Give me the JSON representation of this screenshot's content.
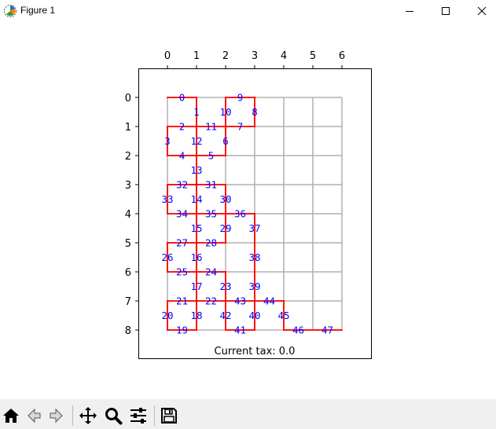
{
  "window": {
    "title": "Figure 1",
    "icon": "matplotlib-icon",
    "controls": [
      "minimize-icon",
      "maximize-icon",
      "close-icon"
    ]
  },
  "toolbar": {
    "buttons": [
      "home-icon",
      "back-icon",
      "forward-icon",
      "pan-icon",
      "zoom-icon",
      "configure-subplots-icon",
      "save-icon"
    ]
  },
  "colors": {
    "frame": "#ff0000",
    "labels": "#0000ff",
    "grid": "#b0b0b0"
  },
  "chart_data": {
    "type": "grid-graph",
    "x_ticks": [
      "0",
      "1",
      "2",
      "3",
      "4",
      "5",
      "6"
    ],
    "y_ticks": [
      "0",
      "1",
      "2",
      "3",
      "4",
      "5",
      "6",
      "7",
      "8"
    ],
    "xlim": [
      -1,
      7
    ],
    "ylim": [
      9,
      -1
    ],
    "x_axis_position": "top",
    "grid": true,
    "status_text": "Current tax: 0.0",
    "nodes": [
      {
        "id": "0",
        "x": 0.5,
        "y": 0
      },
      {
        "id": "1",
        "x": 1,
        "y": 0.5
      },
      {
        "id": "2",
        "x": 0.5,
        "y": 1
      },
      {
        "id": "3",
        "x": 0,
        "y": 1.5
      },
      {
        "id": "4",
        "x": 0.5,
        "y": 2
      },
      {
        "id": "5",
        "x": 1.5,
        "y": 2
      },
      {
        "id": "6",
        "x": 2,
        "y": 1.5
      },
      {
        "id": "7",
        "x": 2.5,
        "y": 1
      },
      {
        "id": "8",
        "x": 3,
        "y": 0.5
      },
      {
        "id": "9",
        "x": 2.5,
        "y": 0
      },
      {
        "id": "10",
        "x": 2,
        "y": 0.5
      },
      {
        "id": "11",
        "x": 1.5,
        "y": 1
      },
      {
        "id": "12",
        "x": 1,
        "y": 1.5
      },
      {
        "id": "13",
        "x": 1,
        "y": 2.5
      },
      {
        "id": "14",
        "x": 1,
        "y": 3.5
      },
      {
        "id": "15",
        "x": 1,
        "y": 4.5
      },
      {
        "id": "16",
        "x": 1,
        "y": 5.5
      },
      {
        "id": "17",
        "x": 1,
        "y": 6.5
      },
      {
        "id": "18",
        "x": 1,
        "y": 7.5
      },
      {
        "id": "19",
        "x": 0.5,
        "y": 8
      },
      {
        "id": "20",
        "x": 0,
        "y": 7.5
      },
      {
        "id": "21",
        "x": 0.5,
        "y": 7
      },
      {
        "id": "22",
        "x": 1.5,
        "y": 7
      },
      {
        "id": "23",
        "x": 2,
        "y": 6.5
      },
      {
        "id": "24",
        "x": 1.5,
        "y": 6
      },
      {
        "id": "25",
        "x": 0.5,
        "y": 6
      },
      {
        "id": "26",
        "x": 0,
        "y": 5.5
      },
      {
        "id": "27",
        "x": 0.5,
        "y": 5
      },
      {
        "id": "28",
        "x": 1.5,
        "y": 5
      },
      {
        "id": "29",
        "x": 2,
        "y": 4.5
      },
      {
        "id": "30",
        "x": 2,
        "y": 3.5
      },
      {
        "id": "31",
        "x": 1.5,
        "y": 3
      },
      {
        "id": "32",
        "x": 0.5,
        "y": 3
      },
      {
        "id": "33",
        "x": 0,
        "y": 3.5
      },
      {
        "id": "34",
        "x": 0.5,
        "y": 4
      },
      {
        "id": "35",
        "x": 1.5,
        "y": 4
      },
      {
        "id": "36",
        "x": 2.5,
        "y": 4
      },
      {
        "id": "37",
        "x": 3,
        "y": 4.5
      },
      {
        "id": "38",
        "x": 3,
        "y": 5.5
      },
      {
        "id": "39",
        "x": 3,
        "y": 6.5
      },
      {
        "id": "40",
        "x": 3,
        "y": 7.5
      },
      {
        "id": "41",
        "x": 2.5,
        "y": 8
      },
      {
        "id": "42",
        "x": 2,
        "y": 7.5
      },
      {
        "id": "43",
        "x": 2.5,
        "y": 7
      },
      {
        "id": "44",
        "x": 3.5,
        "y": 7
      },
      {
        "id": "45",
        "x": 4,
        "y": 7.5
      },
      {
        "id": "46",
        "x": 4.5,
        "y": 8
      },
      {
        "id": "47",
        "x": 5.5,
        "y": 8
      }
    ],
    "red_edges": [
      [
        [
          0,
          0
        ],
        [
          1,
          0
        ]
      ],
      [
        [
          1,
          0
        ],
        [
          1,
          1
        ]
      ],
      [
        [
          0,
          1
        ],
        [
          2,
          1
        ]
      ],
      [
        [
          0,
          1
        ],
        [
          0,
          2
        ]
      ],
      [
        [
          0,
          2
        ],
        [
          2,
          2
        ]
      ],
      [
        [
          2,
          1
        ],
        [
          2,
          2
        ]
      ],
      [
        [
          2,
          0
        ],
        [
          3,
          0
        ]
      ],
      [
        [
          2,
          0
        ],
        [
          2,
          1
        ]
      ],
      [
        [
          3,
          0
        ],
        [
          3,
          1
        ]
      ],
      [
        [
          2,
          1
        ],
        [
          3,
          1
        ]
      ],
      [
        [
          1,
          1
        ],
        [
          1,
          3
        ]
      ],
      [
        [
          0,
          3
        ],
        [
          2,
          3
        ]
      ],
      [
        [
          0,
          3
        ],
        [
          0,
          4
        ]
      ],
      [
        [
          0,
          4
        ],
        [
          3,
          4
        ]
      ],
      [
        [
          2,
          3
        ],
        [
          2,
          5
        ]
      ],
      [
        [
          1,
          3
        ],
        [
          1,
          8
        ]
      ],
      [
        [
          3,
          4
        ],
        [
          3,
          8
        ]
      ],
      [
        [
          0,
          5
        ],
        [
          2,
          5
        ]
      ],
      [
        [
          0,
          5
        ],
        [
          0,
          6
        ]
      ],
      [
        [
          0,
          6
        ],
        [
          2,
          6
        ]
      ],
      [
        [
          2,
          6
        ],
        [
          2,
          8
        ]
      ],
      [
        [
          0,
          7
        ],
        [
          4,
          7
        ]
      ],
      [
        [
          0,
          7
        ],
        [
          0,
          8
        ]
      ],
      [
        [
          0,
          8
        ],
        [
          1,
          8
        ]
      ],
      [
        [
          2,
          8
        ],
        [
          3,
          8
        ]
      ],
      [
        [
          4,
          7
        ],
        [
          4,
          8
        ]
      ],
      [
        [
          4,
          8
        ],
        [
          6,
          8
        ]
      ]
    ]
  }
}
